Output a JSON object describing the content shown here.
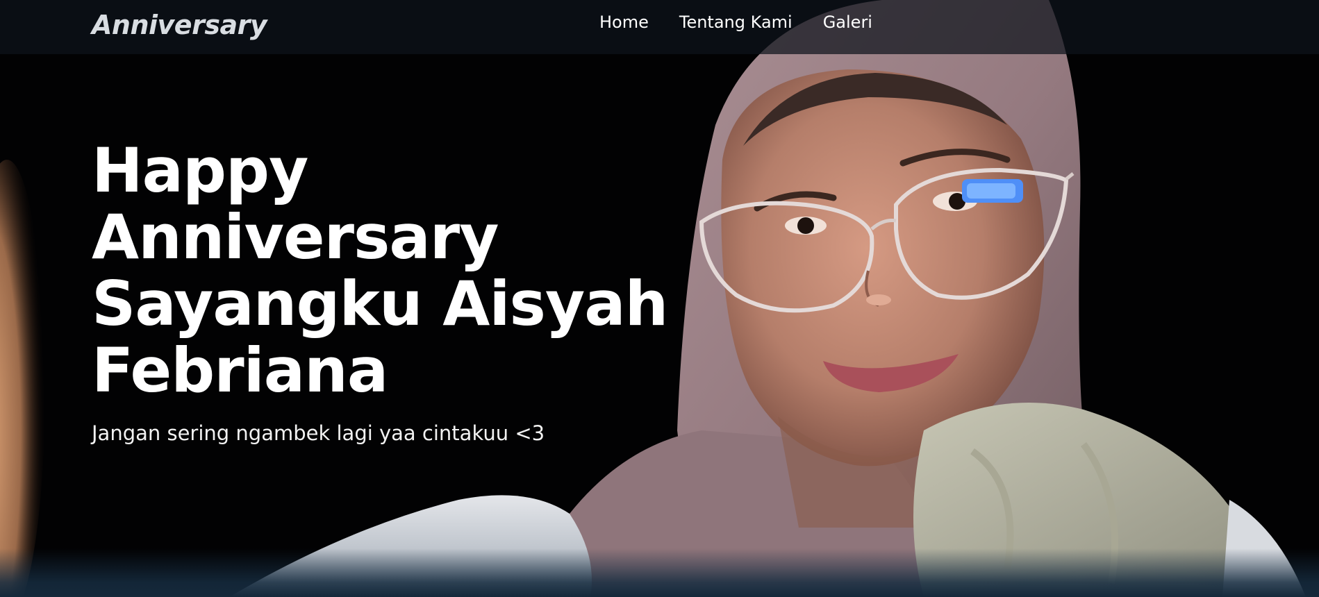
{
  "navbar": {
    "brand": "Anniversary",
    "links": [
      "Home",
      "Tentang Kami",
      "Galeri"
    ]
  },
  "hero": {
    "title": "Happy Anniversary Sayangku Aisyah Febriana",
    "subtitle": "Jangan sering ngambek lagi yaa cintakuu <3"
  },
  "colors": {
    "navbar_bg": "#0e141c",
    "background": "#020203",
    "text": "#ffffff",
    "hijab": "#9c8187",
    "skin": "#c48d78",
    "bottom_band": "#15293b"
  }
}
